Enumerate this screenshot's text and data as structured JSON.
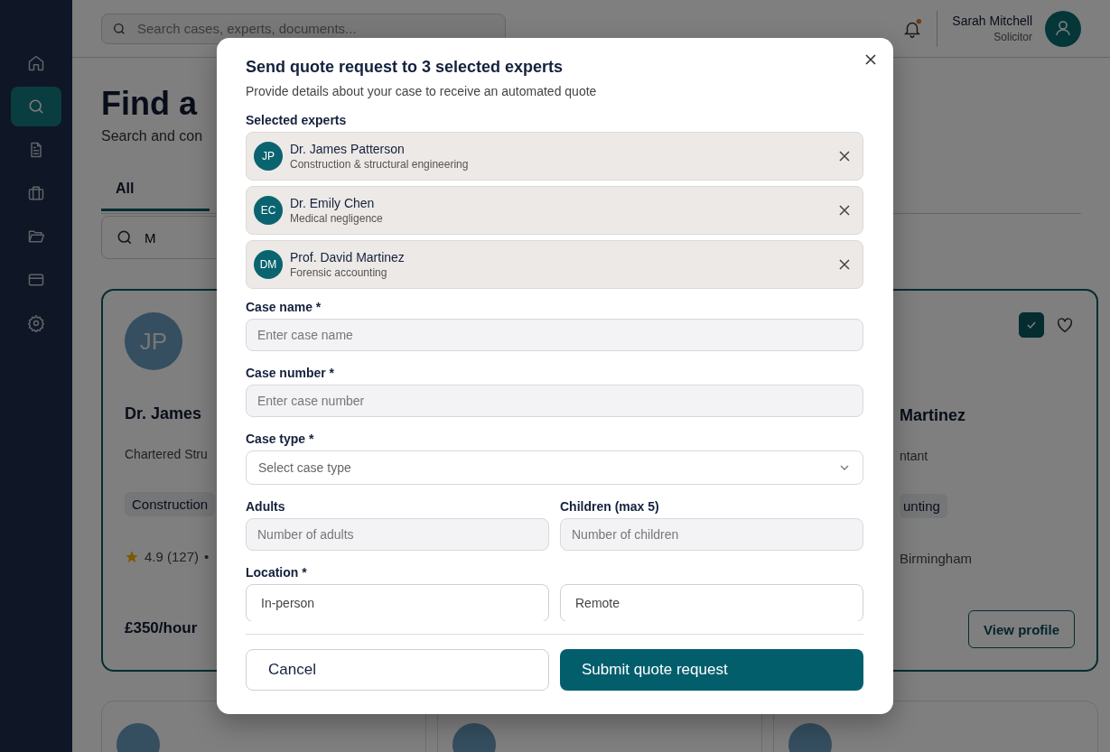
{
  "sidebar": {
    "items": [
      {
        "selected": false
      },
      {
        "selected": true
      },
      {
        "selected": false
      },
      {
        "selected": false
      },
      {
        "selected": false
      },
      {
        "selected": false
      },
      {
        "selected": false
      }
    ]
  },
  "header": {
    "search": {
      "placeholder": "Search cases, experts, documents..."
    },
    "notifications": {
      "unread": true
    },
    "user": {
      "name": "Sarah Mitchell",
      "role": "Solicitor"
    }
  },
  "page": {
    "title": "Find a",
    "subtitle": "Search and con",
    "tabs": [
      {
        "label": "All",
        "selected": true
      }
    ],
    "filter": {
      "value": "M"
    },
    "cards": [
      {
        "initials": "JP",
        "name": "Dr. James",
        "role": "Chartered Stru",
        "tag": "Construction",
        "rating": "4.9 (127)",
        "separator": "•",
        "price": "£350/hour",
        "selected": true
      },
      {
        "name": "Martinez",
        "role": "ntant",
        "tag": "unting",
        "location": "Birmingham",
        "button": "View profile",
        "selected": true,
        "favorite": false
      }
    ]
  },
  "modal": {
    "title": "Send quote request to 3 selected experts",
    "subtitle": "Provide details about your case to receive an automated quote",
    "experts_label": "Selected experts",
    "experts": [
      {
        "initials": "JP",
        "name": "Dr. James Patterson",
        "field": "Construction & structural engineering"
      },
      {
        "initials": "EC",
        "name": "Dr. Emily Chen",
        "field": "Medical negligence"
      },
      {
        "initials": "DM",
        "name": "Prof. David Martinez",
        "field": "Forensic accounting"
      }
    ],
    "fields": [
      {
        "kind": "text",
        "label": "Case name *",
        "placeholder": "Enter case name"
      },
      {
        "kind": "text",
        "label": "Case number *",
        "placeholder": "Enter case number"
      },
      {
        "kind": "select",
        "label": "Case type *",
        "placeholder": "Select case type"
      },
      {
        "kind": "pair",
        "items": [
          {
            "label": "Adults",
            "placeholder": "Number of adults"
          },
          {
            "label": "Children (max 5)",
            "placeholder": "Number of children"
          }
        ]
      },
      {
        "kind": "choice",
        "label": "Location *",
        "options": [
          {
            "label": "In-person",
            "selected": false
          },
          {
            "label": "Remote",
            "selected": false
          }
        ]
      }
    ],
    "buttons": [
      {
        "kind": "secondary",
        "label": "Cancel"
      },
      {
        "kind": "primary",
        "label": "Submit quote request"
      }
    ]
  }
}
